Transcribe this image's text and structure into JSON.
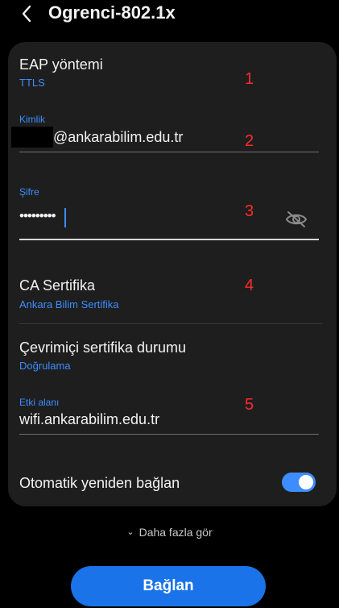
{
  "header": {
    "title": "Ogrenci-802.1x"
  },
  "eap": {
    "label": "EAP yöntemi",
    "value": "TTLS",
    "marker": "1"
  },
  "identity": {
    "label": "Kimlik",
    "value": "@ankarabilim.edu.tr",
    "marker": "2"
  },
  "password": {
    "label": "Şifre",
    "value": "•••••••••",
    "marker": "3"
  },
  "ca_cert": {
    "label": "CA Sertifika",
    "value": "Ankara Bilim Sertifika",
    "marker": "4"
  },
  "online_status": {
    "label": "Çevrimiçi sertifika durumu",
    "value": "Doğrulama"
  },
  "domain": {
    "label": "Etki alanı",
    "value": "wifi.ankarabilim.edu.tr",
    "marker": "5"
  },
  "auto_reconnect": {
    "label": "Otomatik yeniden bağlan",
    "enabled": true
  },
  "more": {
    "label": "Daha fazla gör"
  },
  "connect_button": {
    "label": "Bağlan"
  },
  "colors": {
    "accent": "#3d8dff",
    "marker": "#ff2a2a",
    "card": "#1e1e1e",
    "button": "#1a73e8"
  }
}
